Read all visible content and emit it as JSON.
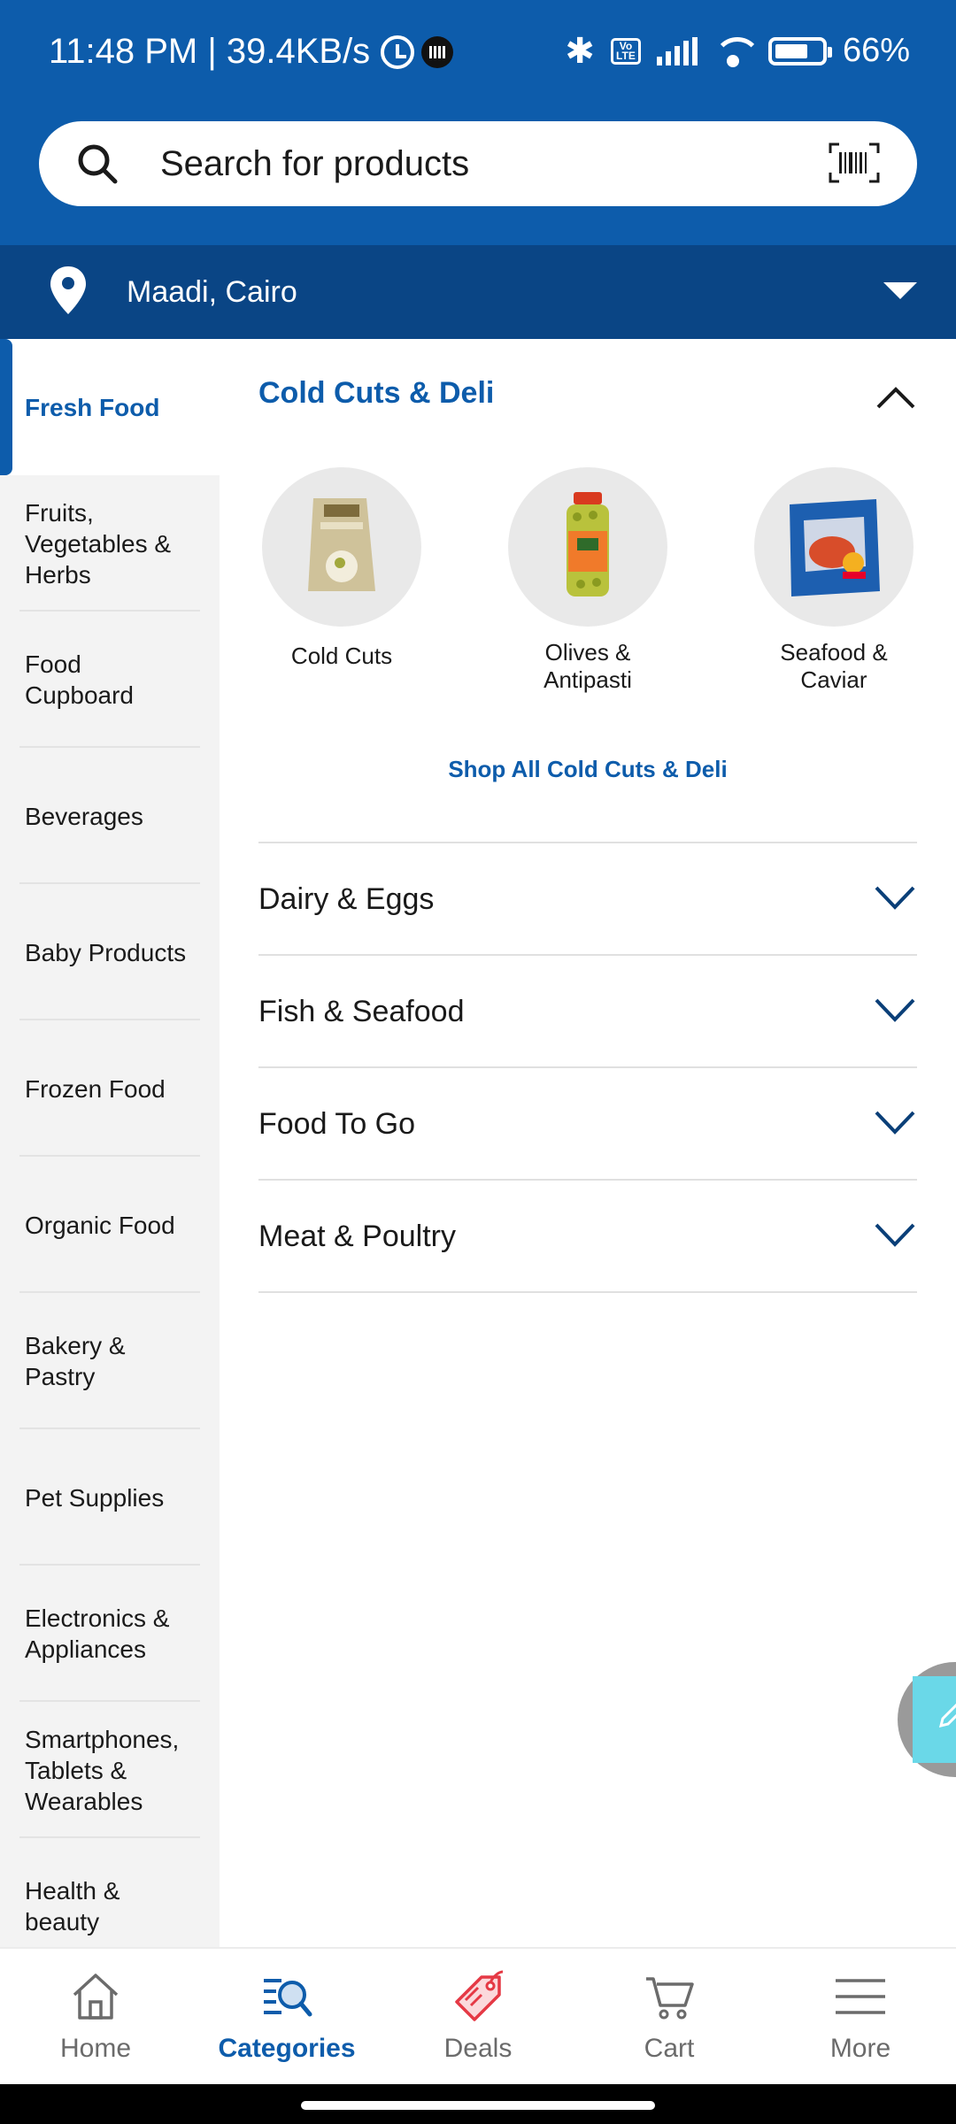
{
  "status_bar": {
    "time": "11:48 PM | 39.4KB/s",
    "battery": "66%"
  },
  "search": {
    "placeholder": "Search for products"
  },
  "location": {
    "label": "Maadi, Cairo"
  },
  "sidebar": {
    "items": [
      {
        "label": "Fresh Food",
        "active": true
      },
      {
        "label": "Fruits, Vegetables & Herbs"
      },
      {
        "label": "Food Cupboard"
      },
      {
        "label": "Beverages"
      },
      {
        "label": "Baby Products"
      },
      {
        "label": "Frozen Food"
      },
      {
        "label": "Organic Food"
      },
      {
        "label": "Bakery & Pastry"
      },
      {
        "label": "Pet Supplies"
      },
      {
        "label": "Electronics & Appliances"
      },
      {
        "label": "Smartphones, Tablets & Wearables"
      },
      {
        "label": "Health & beauty"
      }
    ]
  },
  "main": {
    "open_section": {
      "title": "Cold Cuts & Deli",
      "subcategories": [
        {
          "label": "Cold Cuts"
        },
        {
          "label": "Olives & Antipasti"
        },
        {
          "label": "Seafood & Caviar"
        }
      ],
      "shop_all": "Shop All Cold Cuts & Deli"
    },
    "sections": [
      {
        "title": "Dairy & Eggs"
      },
      {
        "title": "Fish & Seafood"
      },
      {
        "title": "Food To Go"
      },
      {
        "title": "Meat & Poultry"
      }
    ]
  },
  "bottom_nav": {
    "items": [
      {
        "label": "Home",
        "icon": "home-icon"
      },
      {
        "label": "Categories",
        "icon": "categories-icon",
        "active": true
      },
      {
        "label": "Deals",
        "icon": "deals-tag-icon"
      },
      {
        "label": "Cart",
        "icon": "cart-icon"
      },
      {
        "label": "More",
        "icon": "menu-icon"
      }
    ]
  },
  "colors": {
    "brand_blue": "#0d5cab",
    "location_bar": "#0a4585",
    "deals_red": "#e53945"
  }
}
